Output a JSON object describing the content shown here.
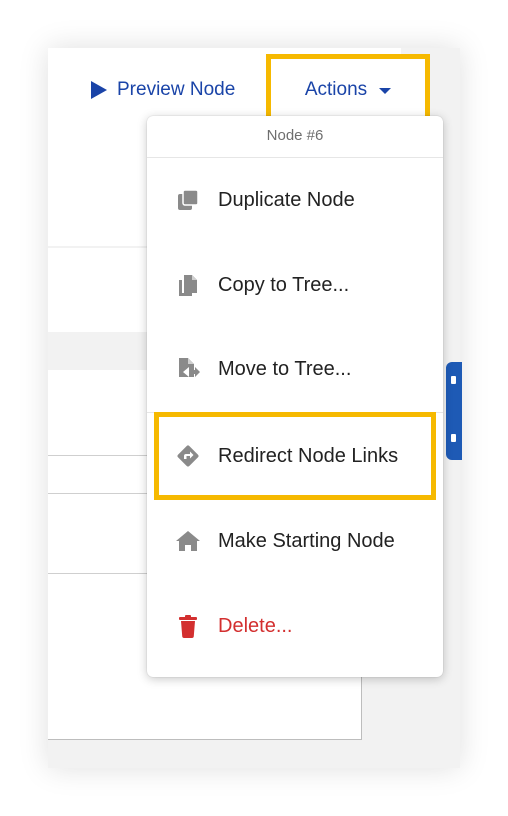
{
  "toolbar": {
    "preview_label": "Preview Node",
    "actions_label": "Actions"
  },
  "menu": {
    "header": "Node #6",
    "items": [
      {
        "label": "Duplicate Node",
        "icon": "duplicate-icon"
      },
      {
        "label": "Copy to Tree...",
        "icon": "copy-file-icon"
      },
      {
        "label": "Move to Tree...",
        "icon": "move-file-icon"
      },
      {
        "label": "Redirect Node Links",
        "icon": "redirect-diamond-icon"
      },
      {
        "label": "Make Starting Node",
        "icon": "home-icon"
      },
      {
        "label": "Delete...",
        "icon": "trash-icon"
      }
    ]
  },
  "colors": {
    "link_blue": "#1a44a8",
    "highlight_yellow": "#f6b900",
    "danger_red": "#d32f2f",
    "icon_gray": "#8a8a8a"
  }
}
